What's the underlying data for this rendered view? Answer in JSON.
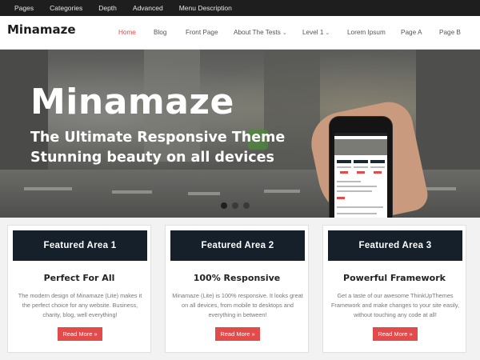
{
  "topbar": {
    "items": [
      "Pages",
      "Categories",
      "Depth",
      "Advanced",
      "Menu Description"
    ]
  },
  "header": {
    "logo": "Minamaze",
    "nav": [
      {
        "label": "Home",
        "active": true,
        "dropdown": false
      },
      {
        "label": "Blog",
        "active": false,
        "dropdown": false
      },
      {
        "label": "Front Page",
        "active": false,
        "dropdown": false
      },
      {
        "label": "About The Tests",
        "active": false,
        "dropdown": true
      },
      {
        "label": "Level 1",
        "active": false,
        "dropdown": true
      },
      {
        "label": "Lorem Ipsum",
        "active": false,
        "dropdown": false
      },
      {
        "label": "Page A",
        "active": false,
        "dropdown": false
      },
      {
        "label": "Page B",
        "active": false,
        "dropdown": false
      }
    ]
  },
  "slider": {
    "title": "Minamaze",
    "subtitle_line1": "The Ultimate Responsive Theme",
    "subtitle_line2": "Stunning beauty on all devices",
    "slide_count": 3,
    "active_slide": 1
  },
  "featured": [
    {
      "heading": "Featured Area 1",
      "title": "Perfect For All",
      "text": "The modern design of Minamaze (Lite) makes it the perfect choice for any website. Business, charity, blog, well everything!",
      "button": "Read More »"
    },
    {
      "heading": "Featured Area 2",
      "title": "100% Responsive",
      "text": "Minamaze (Lite) is 100% responsive. It looks great on all devices, from mobile to desktops and everything in between!",
      "button": "Read More »"
    },
    {
      "heading": "Featured Area 3",
      "title": "Powerful Framework",
      "text": "Get a taste of our awesome ThinkUpThemes Framework and make changes to your site easily, without touching any code at all!",
      "button": "Read More »"
    }
  ],
  "colors": {
    "accent": "#e34b4b",
    "topbar_bg": "#1e1e1e",
    "card_head_bg": "#15202b"
  },
  "icons": {
    "dropdown": "chevron-down-icon",
    "read_more": "double-chevron-right-icon"
  }
}
